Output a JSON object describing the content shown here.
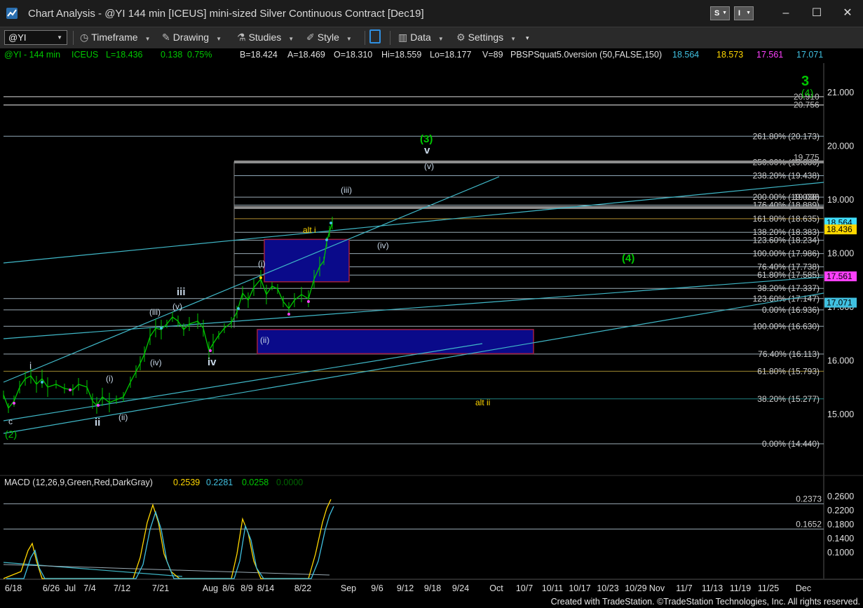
{
  "window": {
    "title": "Chart Analysis - @YI 144 min [ICEUS] mini-sized Silver Continuous Contract [Dec19]",
    "btn_s": "S",
    "btn_i": "I",
    "minimize": "–",
    "maximize": "☐",
    "close": "✕"
  },
  "toolbar": {
    "symbol": "@YI",
    "timeframe": "Timeframe",
    "drawing": "Drawing",
    "studies": "Studies",
    "style": "Style",
    "data": "Data",
    "settings": "Settings"
  },
  "status": {
    "symbol_interval": "@YI - 144 min",
    "exchange": "ICEUS",
    "last": "L=18.436",
    "change": "0.138",
    "change_pct": "0.75%",
    "bid": "B=18.424",
    "ask": "A=18.469",
    "open": "O=18.310",
    "high": "Hi=18.559",
    "low": "Lo=18.177",
    "volume": "V=89",
    "study": "PBSPSquat5.0version (50,FALSE,150)",
    "study_values": [
      "18.564",
      "18.573",
      "17.561",
      "17.071"
    ]
  },
  "colors": {
    "green": "#00c800",
    "yellow": "#ffd700",
    "magenta": "#ff40ff",
    "cyan": "#40c0e0",
    "price_line": "#40e0ff",
    "box": "#0a0a8a"
  },
  "chart_data": {
    "type": "line",
    "ylim": [
      14.1,
      21.4
    ],
    "x_ticks": [
      "6/18",
      "6/26",
      "Jul",
      "7/4",
      "7/12",
      "7/21",
      "Aug",
      "8/6",
      "8/9",
      "8/14",
      "8/22",
      "Sep",
      "9/6",
      "9/12",
      "9/18",
      "9/24",
      "Oct",
      "10/7",
      "10/11",
      "10/17",
      "10/23",
      "10/29",
      "Nov",
      "11/7",
      "11/13",
      "11/19",
      "11/25",
      "Dec"
    ],
    "y_ticks": [
      "21.000",
      "20.000",
      "19.000",
      "18.000",
      "17.000",
      "16.000",
      "15.000"
    ],
    "fib_levels": [
      {
        "label": "261.80% (20.173)",
        "value": 20.173
      },
      {
        "label": "250.00% (19.686)",
        "value": 19.686
      },
      {
        "label": "238.20% (19.438)",
        "value": 19.438
      },
      {
        "label": "200.00% (19.038)",
        "value": 19.038
      },
      {
        "label": "176.40% (18.889)",
        "value": 18.889
      },
      {
        "label": "161.80% (18.635)",
        "value": 18.635
      },
      {
        "label": "138.20% (18.383)",
        "value": 18.383
      },
      {
        "label": "123.60% (18.234)",
        "value": 18.234
      },
      {
        "label": "100.00% (17.986)",
        "value": 17.986
      },
      {
        "label": "76.40% (17.738)",
        "value": 17.738
      },
      {
        "label": "61.80% (17.585)",
        "value": 17.585
      },
      {
        "label": "38.20% (17.337)",
        "value": 17.337
      },
      {
        "label": "123.60% (17.147)",
        "value": 17.147
      },
      {
        "label": "0.00% (16.936)",
        "value": 16.936
      },
      {
        "label": "100.00% (16.630)",
        "value": 16.63
      },
      {
        "label": "76.40% (16.113)",
        "value": 16.113
      },
      {
        "label": "61.80% (15.793)",
        "value": 15.793
      },
      {
        "label": "38.20% (15.277)",
        "value": 15.277
      },
      {
        "label": "0.00% (14.440)",
        "value": 14.44
      }
    ],
    "top_levels": [
      "20.910",
      "20.756",
      "19.775",
      "19.036"
    ],
    "price_badges": [
      {
        "label": "18.564",
        "value": 18.564,
        "color": "#40e0ff"
      },
      {
        "label": "18.436",
        "value": 18.436,
        "color": "#ffd700"
      },
      {
        "label": "17.561",
        "value": 17.561,
        "color": "#ff40ff"
      },
      {
        "label": "17.071",
        "value": 17.071,
        "color": "#40c0e0"
      }
    ],
    "wave_labels": {
      "w3_big": "3",
      "w4_small": "(4)",
      "w3_paren": "(3)",
      "v": "v",
      "v_paren": "(v)",
      "iii_paren": "(iii)",
      "alt_i": "alt i",
      "iv_paren": "(iv)",
      "four_paren": "(4)",
      "i_paren": "(i)",
      "iii": "iii",
      "iii_paren2": "(iii)",
      "v_paren2": "(v)",
      "iv": "iv",
      "iv_paren2": "(iv)",
      "ii_paren": "(ii)",
      "i": "i",
      "i_paren2": "(i)",
      "ii": "ii",
      "ii_paren2": "(ii)",
      "c": "c",
      "two_paren": "(2)",
      "alt_ii": "alt ii"
    },
    "macd": {
      "title": "MACD (12,26,9,Green,Red,DarkGray)",
      "values": [
        "0.2539",
        "0.2281",
        "0.0258",
        "0.0000"
      ],
      "y_ticks": [
        "0.2600",
        "0.2200",
        "0.1800",
        "0.1400",
        "0.1000"
      ],
      "levels": [
        {
          "label": "0.2373",
          "value": 0.2373
        },
        {
          "label": "0.1652",
          "value": 0.1652
        }
      ],
      "ylim": [
        0.06,
        0.29
      ]
    }
  },
  "footer": "Created with TradeStation. ©TradeStation Technologies, Inc. All rights reserved."
}
